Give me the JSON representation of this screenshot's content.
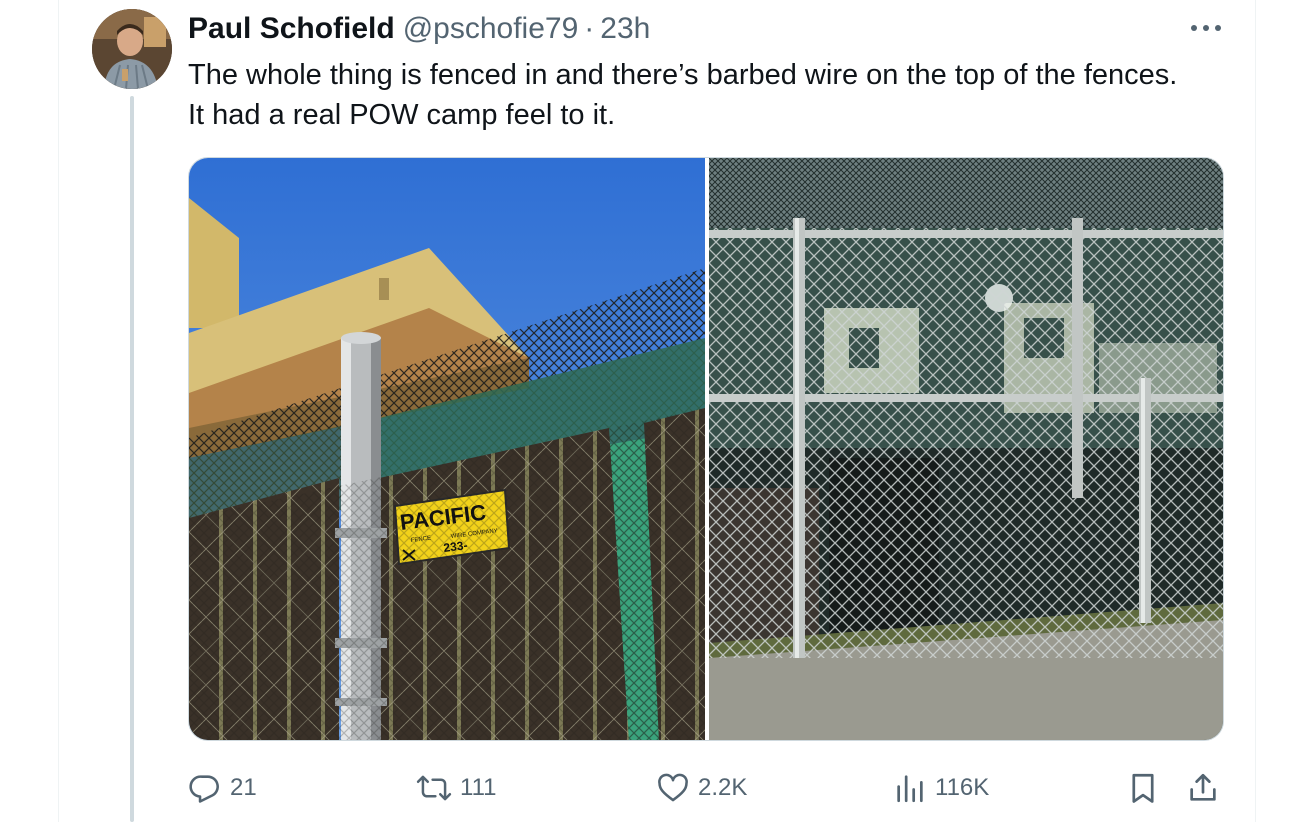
{
  "tweet": {
    "author_name": "Paul Schofield",
    "author_handle": "@pschofie79",
    "separator": "·",
    "timestamp": "23h",
    "text": "The whole thing is fenced in and there’s barbed wire on the top of the fences. It had a real POW camp feel to it."
  },
  "media": {
    "left_photo": {
      "sign_brand": "PACIFIC",
      "sign_line1": "FENCE",
      "sign_line2": "WIRE COMPANY",
      "sign_phone": "233-"
    }
  },
  "actions": {
    "reply_count": "21",
    "repost_count": "111",
    "like_count": "2.2K",
    "view_count": "116K"
  },
  "icons": {
    "more": "more-horizontal-icon",
    "reply": "reply-icon",
    "repost": "repost-icon",
    "like": "heart-icon",
    "views": "views-icon",
    "bookmark": "bookmark-icon",
    "share": "share-icon"
  },
  "colors": {
    "text_primary": "#0f1419",
    "text_secondary": "#536471",
    "border": "#cfd9de"
  }
}
